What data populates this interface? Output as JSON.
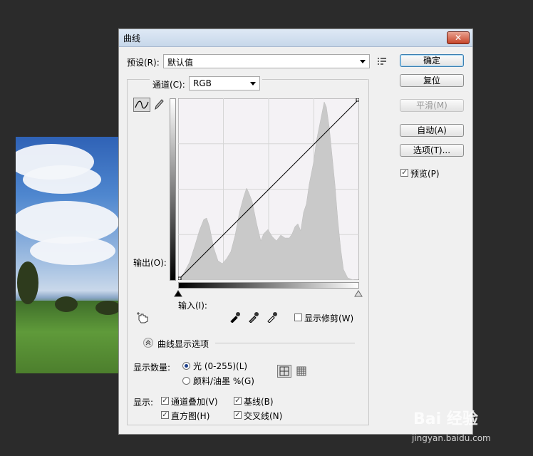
{
  "dialog": {
    "title": "曲线",
    "close_glyph": "✕",
    "preset_label": "预设(R):",
    "preset_value": "默认值",
    "channel_label": "通道(C):",
    "channel_value": "RGB",
    "output_label": "输出(O):",
    "input_label": "输入(I):",
    "show_clipping_label": "显示修剪(W)",
    "show_clipping_checked": false,
    "curve_options_label": "曲线显示选项",
    "show_amount_label": "显示数量:",
    "amount_options": [
      {
        "label": "光 (0-255)(L)",
        "selected": true
      },
      {
        "label": "颜料/油墨 %(G)",
        "selected": false
      }
    ],
    "show_label": "显示:",
    "show_options": [
      {
        "label": "通道叠加(V)",
        "checked": true
      },
      {
        "label": "基线(B)",
        "checked": true
      },
      {
        "label": "直方图(H)",
        "checked": true
      },
      {
        "label": "交叉线(N)",
        "checked": true
      }
    ]
  },
  "buttons": {
    "ok": "确定",
    "reset": "复位",
    "smooth": "平滑(M)",
    "auto": "自动(A)",
    "options": "选项(T)..."
  },
  "preview": {
    "label": "预览(P)",
    "checked": true
  },
  "watermark": {
    "brand": "Bai 经验",
    "url": "jingyan.baidu.com"
  },
  "colors": {
    "histogram": "#c9c9c9",
    "curve": "#000000",
    "grid": "#d6d6d6"
  }
}
